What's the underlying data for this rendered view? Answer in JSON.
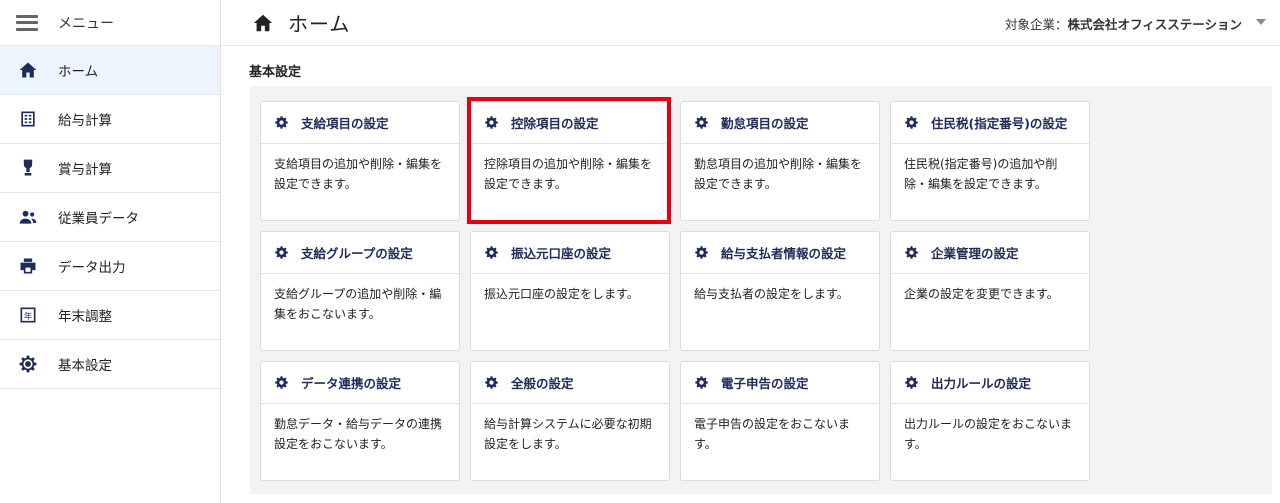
{
  "sidebar": {
    "menu_label": "メニュー",
    "items": [
      {
        "label": "ホーム",
        "icon": "home-icon"
      },
      {
        "label": "給与計算",
        "icon": "calculator-icon"
      },
      {
        "label": "賞与計算",
        "icon": "award-icon"
      },
      {
        "label": "従業員データ",
        "icon": "people-icon"
      },
      {
        "label": "データ出力",
        "icon": "printer-icon"
      },
      {
        "label": "年末調整",
        "icon": "year-icon"
      },
      {
        "label": "基本設定",
        "icon": "gear-icon"
      }
    ]
  },
  "header": {
    "title": "ホーム",
    "company_label": "対象企業：",
    "company_name": "株式会社オフィスステーション"
  },
  "main": {
    "section_title": "基本設定",
    "cards": [
      {
        "title": "支給項目の設定",
        "desc": "支給項目の追加や削除・編集を設定できます。"
      },
      {
        "title": "控除項目の設定",
        "desc": "控除項目の追加や削除・編集を設定できます。"
      },
      {
        "title": "勤怠項目の設定",
        "desc": "勤怠項目の追加や削除・編集を設定できます。"
      },
      {
        "title": "住民税(指定番号)の設定",
        "desc": "住民税(指定番号)の追加や削除・編集を設定できます。"
      },
      {
        "title": "支給グループの設定",
        "desc": "支給グループの追加や削除・編集をおこないます。"
      },
      {
        "title": "振込元口座の設定",
        "desc": "振込元口座の設定をします。"
      },
      {
        "title": "給与支払者情報の設定",
        "desc": "給与支払者の設定をします。"
      },
      {
        "title": "企業管理の設定",
        "desc": "企業の設定を変更できます。"
      },
      {
        "title": "データ連携の設定",
        "desc": "勤怠データ・給与データの連携設定をおこないます。"
      },
      {
        "title": "全般の設定",
        "desc": "給与計算システムに必要な初期設定をします。"
      },
      {
        "title": "電子申告の設定",
        "desc": "電子申告の設定をおこないます。"
      },
      {
        "title": "出力ルールの設定",
        "desc": "出力ルールの設定をおこないます。"
      }
    ]
  },
  "colors": {
    "accent": "#1f2b59",
    "highlight": "#e60012",
    "active_bg": "#eef4fb",
    "panel_bg": "#f3f3f3"
  }
}
